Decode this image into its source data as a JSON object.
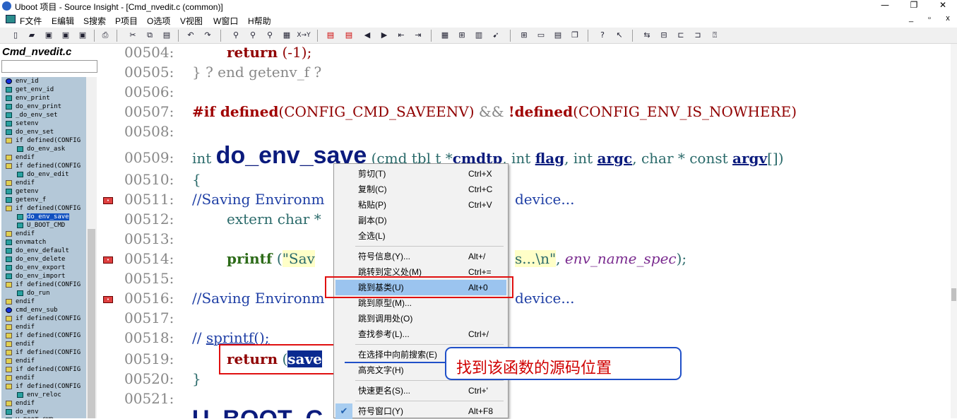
{
  "window": {
    "title": "Uboot 项目 - Source Insight - [Cmd_nvedit.c (common)]",
    "minimize": "—",
    "restore": "❐",
    "close": "✕"
  },
  "menu": {
    "items": [
      "F文件",
      "E编辑",
      "S搜索",
      "P项目",
      "O选项",
      "V视图",
      "W窗口",
      "H帮助"
    ],
    "mdi_min": "_",
    "mdi_restore": "▫",
    "mdi_close": "x"
  },
  "toolbar": {
    "icons": [
      "new-file-icon",
      "open-folder-icon",
      "save-icon",
      "save-as-icon",
      "save-all-icon",
      "print-icon",
      "cut-icon",
      "copy-icon",
      "paste-icon",
      "undo-icon",
      "redo-icon",
      "search-icon",
      "search-files-icon",
      "search-next-icon",
      "search-project-icon",
      "replace-icon",
      "bookmark-icon",
      "bookmark-next-icon",
      "back-icon",
      "forward-icon",
      "indent-left-icon",
      "indent-right-icon",
      "browse-symbols-icon",
      "relation-icon",
      "book-icon",
      "jump-icon",
      "layout-icon",
      "tile-icon",
      "window-icon",
      "cascade-icon",
      "help-icon",
      "context-help-icon",
      "sync-icon",
      "project-window-icon",
      "relation-window-icon",
      "symbol-window-icon",
      "info-icon"
    ],
    "xy_label": "X→Y"
  },
  "symbol_window": {
    "file_name": "Cmd_nvedit.c",
    "items": [
      {
        "label": "env_id",
        "icon": "oval",
        "sub": false
      },
      {
        "label": "get_env_id",
        "icon": "box",
        "sub": false
      },
      {
        "label": "env_print",
        "icon": "box",
        "sub": false
      },
      {
        "label": "do_env_print",
        "icon": "box",
        "sub": false
      },
      {
        "label": "_do_env_set",
        "icon": "box",
        "sub": false
      },
      {
        "label": "setenv",
        "icon": "box",
        "sub": false
      },
      {
        "label": "do_env_set",
        "icon": "box",
        "sub": false
      },
      {
        "label": "if defined(CONFIG",
        "icon": "grid",
        "sub": false
      },
      {
        "label": "do_env_ask",
        "icon": "box",
        "sub": true
      },
      {
        "label": "endif",
        "icon": "grid",
        "sub": false
      },
      {
        "label": "if defined(CONFIG",
        "icon": "grid",
        "sub": false
      },
      {
        "label": "do_env_edit",
        "icon": "box",
        "sub": true
      },
      {
        "label": "endif",
        "icon": "grid",
        "sub": false
      },
      {
        "label": "getenv",
        "icon": "box",
        "sub": false
      },
      {
        "label": "getenv_f",
        "icon": "box",
        "sub": false
      },
      {
        "label": "if defined(CONFIG",
        "icon": "grid",
        "sub": false
      },
      {
        "label": "do_env_save",
        "icon": "box",
        "sub": true,
        "selected": true
      },
      {
        "label": "U_BOOT_CMD",
        "icon": "box",
        "sub": true
      },
      {
        "label": "endif",
        "icon": "grid",
        "sub": false
      },
      {
        "label": "envmatch",
        "icon": "box",
        "sub": false
      },
      {
        "label": "do_env_default",
        "icon": "box",
        "sub": false
      },
      {
        "label": "do_env_delete",
        "icon": "box",
        "sub": false
      },
      {
        "label": "do_env_export",
        "icon": "box",
        "sub": false
      },
      {
        "label": "do_env_import",
        "icon": "box",
        "sub": false
      },
      {
        "label": "if defined(CONFIG",
        "icon": "grid",
        "sub": false
      },
      {
        "label": "do_run",
        "icon": "box",
        "sub": true
      },
      {
        "label": "endif",
        "icon": "grid",
        "sub": false
      },
      {
        "label": "cmd_env_sub",
        "icon": "oval",
        "sub": false
      },
      {
        "label": "if defined(CONFIG",
        "icon": "grid",
        "sub": false
      },
      {
        "label": "endif",
        "icon": "grid",
        "sub": false
      },
      {
        "label": "if defined(CONFIG",
        "icon": "grid",
        "sub": false
      },
      {
        "label": "endif",
        "icon": "grid",
        "sub": false
      },
      {
        "label": "if defined(CONFIG",
        "icon": "grid",
        "sub": false
      },
      {
        "label": "endif",
        "icon": "grid",
        "sub": false
      },
      {
        "label": "if defined(CONFIG",
        "icon": "grid",
        "sub": false
      },
      {
        "label": "endif",
        "icon": "grid",
        "sub": false
      },
      {
        "label": "if defined(CONFIG",
        "icon": "grid",
        "sub": false
      },
      {
        "label": "env_reloc",
        "icon": "box",
        "sub": true
      },
      {
        "label": "endif",
        "icon": "grid",
        "sub": false
      },
      {
        "label": "do_env",
        "icon": "box",
        "sub": false
      },
      {
        "label": "U_BOOT_CMD",
        "icon": "box",
        "sub": false
      }
    ]
  },
  "editor": {
    "lines": [
      {
        "num": "00504:"
      },
      {
        "num": "00505:"
      },
      {
        "num": "00506:"
      },
      {
        "num": "00507:"
      },
      {
        "num": "00508:"
      },
      {
        "num": "00509:"
      },
      {
        "num": "00510:"
      },
      {
        "num": "00511:"
      },
      {
        "num": "00512:"
      },
      {
        "num": "00513:"
      },
      {
        "num": "00514:"
      },
      {
        "num": "00515:"
      },
      {
        "num": "00516:"
      },
      {
        "num": "00517:"
      },
      {
        "num": "00518:"
      },
      {
        "num": "00519:"
      },
      {
        "num": "00520:"
      },
      {
        "num": "00521:"
      }
    ],
    "code": {
      "l504_kw": "return",
      "l504_rest": " (-1);",
      "l505": "} ? end getenv_f ?",
      "l507_pre1": "#if defined",
      "l507_arg1": "(CONFIG_CMD_SAVEENV)",
      "l507_op": " && ",
      "l507_pre2": "!defined",
      "l507_arg2": "(CONFIG_ENV_IS_NOWHERE)",
      "l509_int": "int ",
      "l509_name": "do_env_save",
      "l509_p1": " (cmd tbl t *",
      "l509_cmdtp": "cmdtp",
      "l509_p2": ", int ",
      "l509_flag": "flag",
      "l509_p3": ", int ",
      "l509_argc": "argc",
      "l509_p4": ", char * const ",
      "l509_argv": "argv",
      "l509_p5": "[])",
      "l510": "{",
      "l511_a": "//Saving Environm",
      "l511_b": "device...",
      "l512": "extern char *",
      "l514_fn": "printf",
      "l514_open": " (",
      "l514_str": "\"Sav",
      "l514_str2": "s...\\n\"",
      "l514_comma": ", ",
      "l514_var": "env_name_spec",
      "l514_end": ");",
      "l516_a": "//Saving Environm",
      "l516_b": "device...",
      "l518_a": "// ",
      "l518_b": "sprintf();",
      "l519_kw": "return",
      "l519_open": " (",
      "l519_sel": "save",
      "l520": "}",
      "l522": "U_BOOT_C"
    }
  },
  "context_menu": {
    "items": [
      {
        "label": "剪切(T)",
        "key": "Ctrl+X"
      },
      {
        "label": "复制(C)",
        "key": "Ctrl+C"
      },
      {
        "label": "粘贴(P)",
        "key": "Ctrl+V"
      },
      {
        "label": "副本(D)",
        "key": ""
      },
      {
        "label": "全选(L)",
        "key": ""
      },
      {
        "label": "符号信息(Y)...",
        "key": "Alt+/"
      },
      {
        "label": "跳转到定义处(M)",
        "key": "Ctrl+="
      },
      {
        "label": "跳到基类(U)",
        "key": "Alt+0"
      },
      {
        "label": "跳到原型(M)...",
        "key": ""
      },
      {
        "label": "跳到调用处(O)",
        "key": ""
      },
      {
        "label": "查找参考(L)...",
        "key": "Ctrl+/"
      },
      {
        "label": "在选择中向前搜索(E)",
        "key": ""
      },
      {
        "label": "高亮文字(H)",
        "key": ""
      },
      {
        "label": "快速更名(S)...",
        "key": "Ctrl+'"
      },
      {
        "label": "符号窗口(Y)",
        "key": "Alt+F8"
      }
    ],
    "check": "✔"
  },
  "annotation": {
    "callout_text": "找到该函数的源码位置",
    "highlight_color": "#e01010",
    "callout_border_color": "#2050c8"
  }
}
